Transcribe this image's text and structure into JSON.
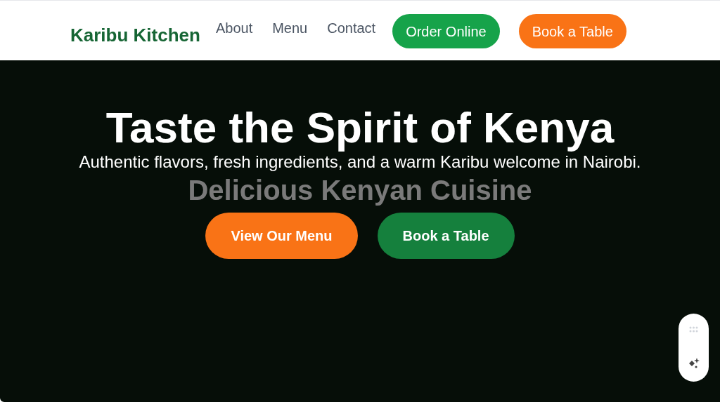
{
  "nav": {
    "logo": "Karibu Kitchen",
    "links": [
      "About",
      "Menu",
      "Contact"
    ],
    "buttons": [
      {
        "label": "Order Online",
        "kind": "green"
      },
      {
        "label": "Book a Table",
        "kind": "orange"
      }
    ]
  },
  "hero": {
    "title": "Taste the Spirit of Kenya",
    "subtitle": "Authentic flavors, fresh ingredients, and a warm Karibu welcome in Nairobi.",
    "background_heading": "Delicious Kenyan Cuisine",
    "buttons": [
      {
        "label": "View Our Menu",
        "kind": "orange"
      },
      {
        "label": "Book a Table",
        "kind": "green"
      }
    ]
  }
}
